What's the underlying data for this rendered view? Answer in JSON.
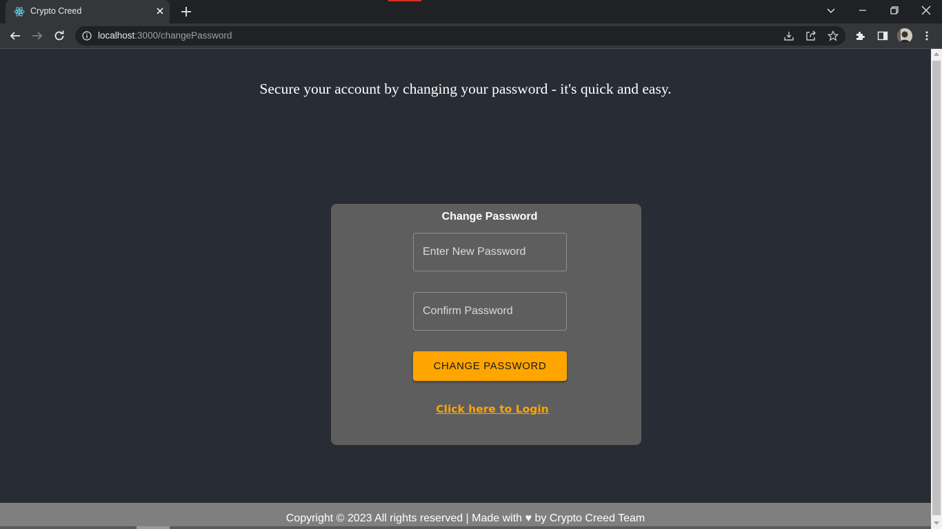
{
  "browser": {
    "tab_title": "Crypto Creed",
    "url_host": "localhost",
    "url_rest": ":3000/changePassword",
    "icons": {
      "favicon": "react-logo-icon",
      "tab_close": "close-icon",
      "new_tab": "plus-icon",
      "tab_search": "chevron-down-icon",
      "minimize": "minimize-icon",
      "restore": "restore-icon",
      "close_window": "close-icon",
      "back": "arrow-left-icon",
      "forward": "arrow-right-icon",
      "reload": "reload-icon",
      "site_info": "info-icon",
      "install": "download-icon",
      "share": "share-icon",
      "bookmark": "star-icon",
      "extensions": "puzzle-icon",
      "side_panel": "side-panel-icon",
      "menu": "kebab-menu-icon"
    }
  },
  "page": {
    "tagline": "Secure your account by changing your password - it's quick and easy.",
    "form": {
      "title": "Change Password",
      "new_password_placeholder": "Enter New Password",
      "confirm_password_placeholder": "Confirm Password",
      "submit_label": "CHANGE PASSWORD",
      "login_link": "Click here to Login"
    },
    "footer": {
      "text": "Copyright © 2023 All rights reserved | Made with ♥ by Crypto Creed Team"
    }
  },
  "colors": {
    "page_background": "#282c34",
    "card_background": "#5e5e5e",
    "accent": "#ffa500",
    "footer_background": "#7f7f7f"
  }
}
